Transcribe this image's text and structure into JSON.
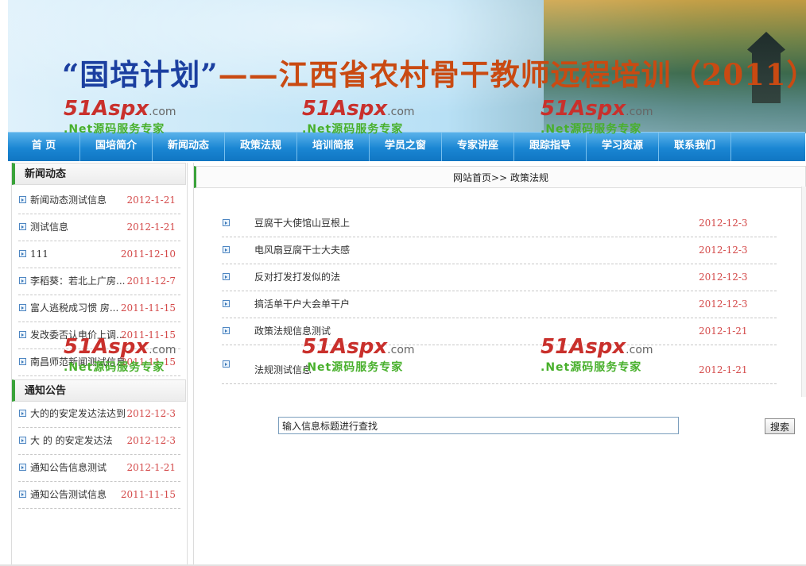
{
  "banner": {
    "title_part1": "“国培计划”",
    "title_part2": "——江西省农村骨干教师远程培训（2011）"
  },
  "watermark": {
    "logo_main": "51Aspx",
    "logo_suffix": ".com",
    "tagline": ".Net源码服务专家"
  },
  "nav": {
    "items": [
      "首  页",
      "国培简介",
      "新闻动态",
      "政策法规",
      "培训简报",
      "学员之窗",
      "专家讲座",
      "跟踪指导",
      "学习资源",
      "联系我们"
    ]
  },
  "news_box": {
    "title": "新闻动态",
    "items": [
      {
        "title": "新闻动态测试信息",
        "date": "2012-1-21"
      },
      {
        "title": "测试信息",
        "date": "2012-1-21"
      },
      {
        "title": "111",
        "date": "2011-12-10"
      },
      {
        "title": "李稻葵：若北上广房...",
        "date": "2011-12-7"
      },
      {
        "title": "富人逃税成习惯 房...",
        "date": "2011-11-15"
      },
      {
        "title": "发改委否认电价上调...",
        "date": "2011-11-15"
      },
      {
        "title": "南昌师范新闻测试信息",
        "date": "2011-11-15"
      }
    ]
  },
  "notice_box": {
    "title": "通知公告",
    "items": [
      {
        "title": "大的的安定发达法达到",
        "date": "2012-12-3"
      },
      {
        "title": "大 的 的安定发达法",
        "date": "2012-12-3"
      },
      {
        "title": "通知公告信息测试",
        "date": "2012-1-21"
      },
      {
        "title": "通知公告测试信息",
        "date": "2011-11-15"
      }
    ]
  },
  "breadcrumb": "网站首页>> 政策法规",
  "articles": [
    {
      "title": "豆腐干大使馆山豆根上",
      "date": "2012-12-3"
    },
    {
      "title": "电风扇豆腐干士大夫感",
      "date": "2012-12-3"
    },
    {
      "title": "反对打发打发似的法",
      "date": "2012-12-3"
    },
    {
      "title": "搞活单干户大会单干户",
      "date": "2012-12-3"
    },
    {
      "title": "政策法规信息测试",
      "date": "2012-1-21"
    },
    {
      "title": "法规测试信息",
      "date": "2012-1-21"
    }
  ],
  "search": {
    "value": "输入信息标题进行查找",
    "button_label": "搜索"
  },
  "colors": {
    "nav_blue": "#1a86d3",
    "date_red": "#d44a4a",
    "accent_green": "#3aa33a",
    "title_blue": "#1b3fa0",
    "title_orange": "#c94a12",
    "watermark_red": "#c9302c",
    "watermark_green": "#48b02c"
  }
}
